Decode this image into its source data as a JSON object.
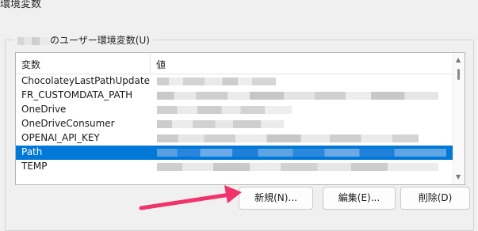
{
  "window": {
    "title": "環境変数"
  },
  "user_section": {
    "label": "のユーザー環境変数(U)"
  },
  "table": {
    "col_variable": "変数",
    "col_value": "値",
    "rows": [
      {
        "name": "ChocolateyLastPathUpdate"
      },
      {
        "name": "FR_CUSTOMDATA_PATH"
      },
      {
        "name": "OneDrive"
      },
      {
        "name": "OneDriveConsumer"
      },
      {
        "name": "OPENAI_API_KEY"
      },
      {
        "name": "Path",
        "selected": true
      },
      {
        "name": "TEMP"
      }
    ]
  },
  "buttons": {
    "new": "新規(N)...",
    "edit": "編集(E)...",
    "delete": "削除(D)"
  },
  "colors": {
    "selection": "#0078d7",
    "arrow": "#f0336a"
  },
  "icons": {
    "scroll_up": "triangle-up-icon",
    "scroll_down": "triangle-down-icon",
    "annotation": "pink-arrow-icon"
  }
}
